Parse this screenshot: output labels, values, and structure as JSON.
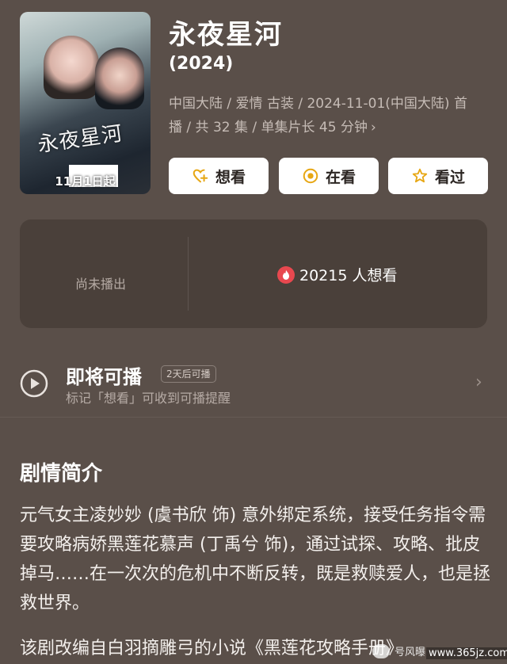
{
  "poster": {
    "title_art": "永夜星河",
    "date_text": "11月1日起"
  },
  "show": {
    "title": "永夜星河",
    "year": "(2024)",
    "meta_line1": "中国大陆 / 爱情 古装 / 2024-11-01(中国大陆) 首",
    "meta_line2": "播 / 共 32 集 / 单集片长 45 分钟"
  },
  "actions": {
    "want": "想看",
    "watching": "在看",
    "watched": "看过"
  },
  "stats": {
    "not_aired": "尚未播出",
    "want_count": "20215 人想看"
  },
  "upcoming": {
    "title": "即将可播",
    "badge": "2天后可播",
    "subtitle": "标记「想看」可收到可播提醒"
  },
  "synopsis": {
    "heading": "剧情简介",
    "body": "元气女主凌妙妙 (虞书欣 饰) 意外绑定系统，接受任务指令需要攻略病娇黑莲花慕声 (丁禹兮 饰)，通过试探、攻略、批皮掉马……在一次次的危机中不断反转，既是救赎爱人，也是拯救世界。",
    "more": "该剧改编自白羽摘雕弓的小说《黑莲花攻略手册》"
  },
  "watermark": {
    "text": "号风曝",
    "url": "www.365jz.com"
  },
  "colors": {
    "background": "#5a4f49",
    "card": "#4a403a",
    "button_bg": "#ffffff",
    "accent_yellow": "#e7a714",
    "flame_red": "#e8484f"
  }
}
